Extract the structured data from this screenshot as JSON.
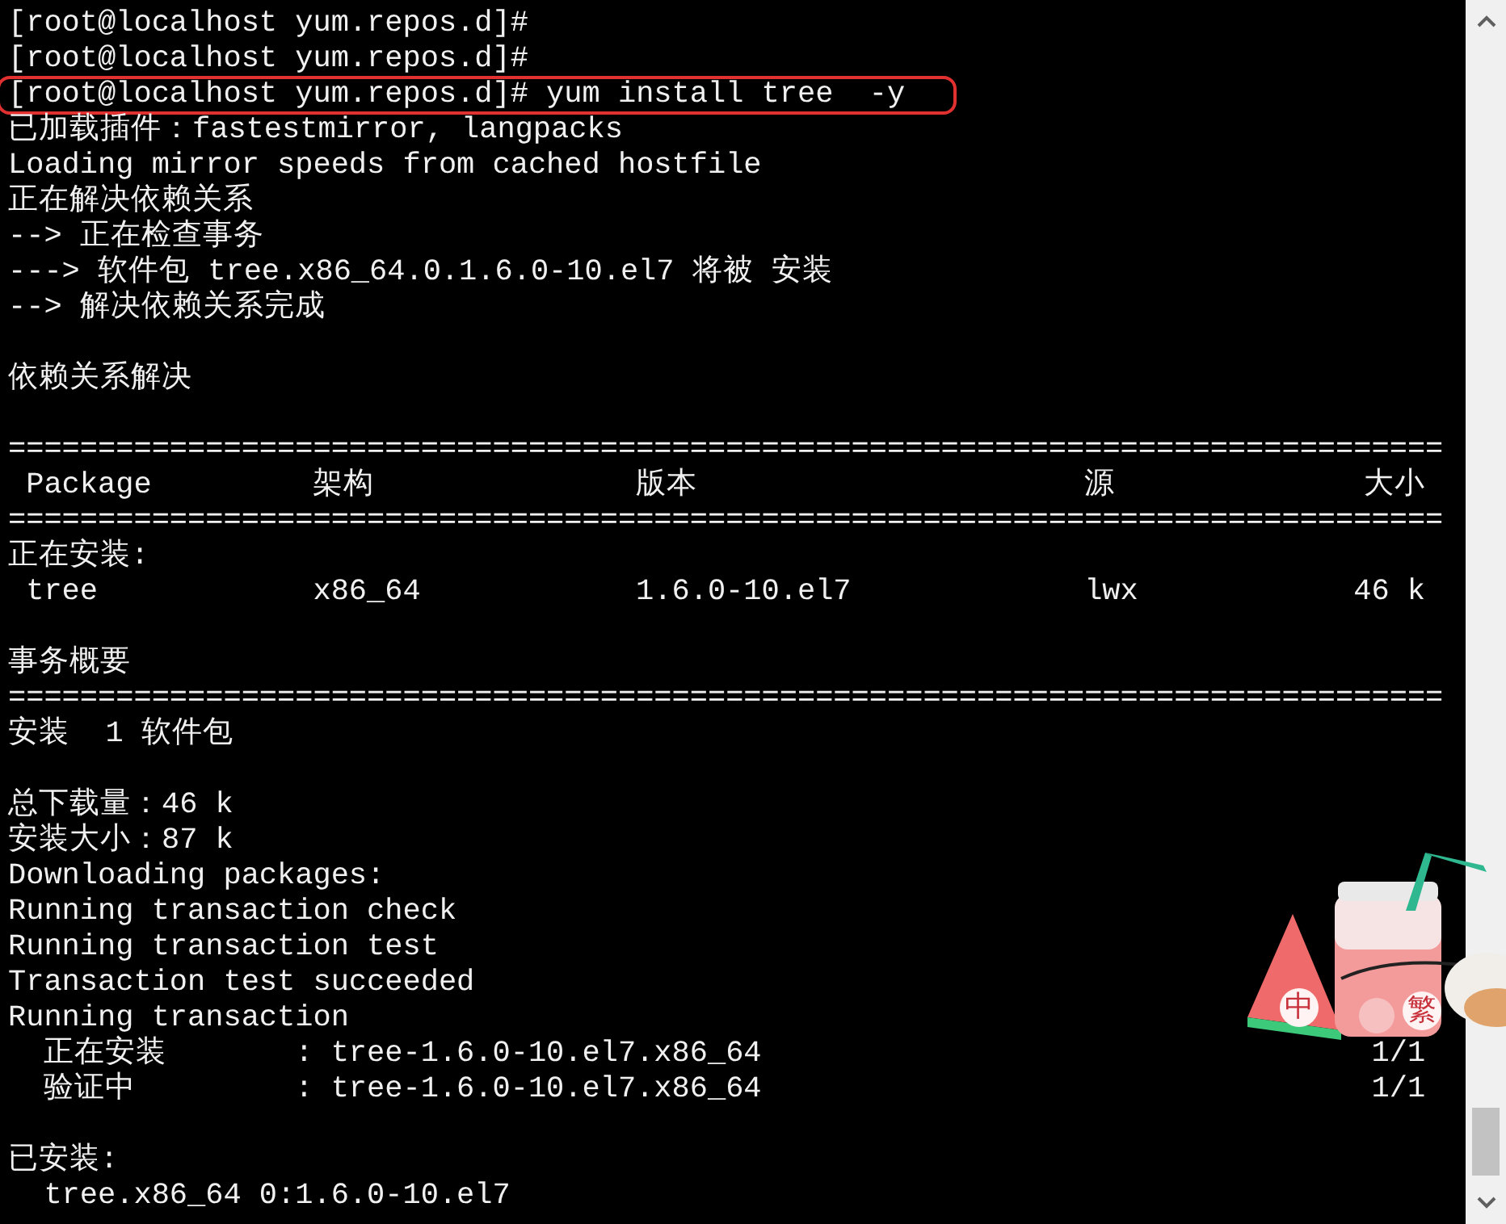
{
  "terminal": {
    "lines": [
      {
        "kind": "text",
        "text": "[root@localhost yum.repos.d]#",
        "highlighted": false
      },
      {
        "kind": "text",
        "text": "[root@localhost yum.repos.d]#",
        "highlighted": false
      },
      {
        "kind": "text",
        "text": "[root@localhost yum.repos.d]# yum install tree  -y",
        "highlighted": true
      },
      {
        "kind": "text",
        "text": "已加载插件：fastestmirror, langpacks",
        "highlighted": false
      },
      {
        "kind": "text",
        "text": "Loading mirror speeds from cached hostfile",
        "highlighted": false
      },
      {
        "kind": "text",
        "text": "正在解决依赖关系",
        "highlighted": false
      },
      {
        "kind": "text",
        "text": "--> 正在检查事务",
        "highlighted": false
      },
      {
        "kind": "text",
        "text": "---> 软件包 tree.x86_64.0.1.6.0-10.el7 将被 安装",
        "highlighted": false
      },
      {
        "kind": "text",
        "text": "--> 解决依赖关系完成",
        "highlighted": false
      },
      {
        "kind": "gap"
      },
      {
        "kind": "text",
        "text": "依赖关系解决",
        "highlighted": false
      },
      {
        "kind": "gap"
      },
      {
        "kind": "rule",
        "text": "================================================================================"
      },
      {
        "kind": "table",
        "cells": [
          "Package",
          "架构",
          "版本",
          "源",
          "大小"
        ]
      },
      {
        "kind": "rule",
        "text": "================================================================================"
      },
      {
        "kind": "text",
        "text": "正在安装:",
        "highlighted": false
      },
      {
        "kind": "table",
        "cells": [
          "tree",
          "x86_64",
          "1.6.0-10.el7",
          "lwx",
          "46 k"
        ]
      },
      {
        "kind": "gap"
      },
      {
        "kind": "text",
        "text": "事务概要",
        "highlighted": false
      },
      {
        "kind": "rule",
        "text": "================================================================================"
      },
      {
        "kind": "text",
        "text": "安装  1 软件包",
        "highlighted": false
      },
      {
        "kind": "gap"
      },
      {
        "kind": "text",
        "text": "总下载量：46 k",
        "highlighted": false
      },
      {
        "kind": "text",
        "text": "安装大小：87 k",
        "highlighted": false
      },
      {
        "kind": "text",
        "text": "Downloading packages:",
        "highlighted": false
      },
      {
        "kind": "text",
        "text": "Running transaction check",
        "highlighted": false
      },
      {
        "kind": "text",
        "text": "Running transaction test",
        "highlighted": false
      },
      {
        "kind": "text",
        "text": "Transaction test succeeded",
        "highlighted": false
      },
      {
        "kind": "text",
        "text": "Running transaction",
        "highlighted": false
      },
      {
        "kind": "progress",
        "step": "正在安装",
        "package": ": tree-1.6.0-10.el7.x86_64",
        "count": "1/1"
      },
      {
        "kind": "progress",
        "step": "验证中",
        "package": ": tree-1.6.0-10.el7.x86_64",
        "count": "1/1"
      },
      {
        "kind": "gap"
      },
      {
        "kind": "text",
        "text": "已安装:",
        "highlighted": false
      },
      {
        "kind": "text",
        "text": "  tree.x86_64 0:1.6.0-10.el7",
        "highlighted": false
      }
    ]
  },
  "ime_sticker": {
    "labels": [
      "中",
      "繁"
    ]
  }
}
